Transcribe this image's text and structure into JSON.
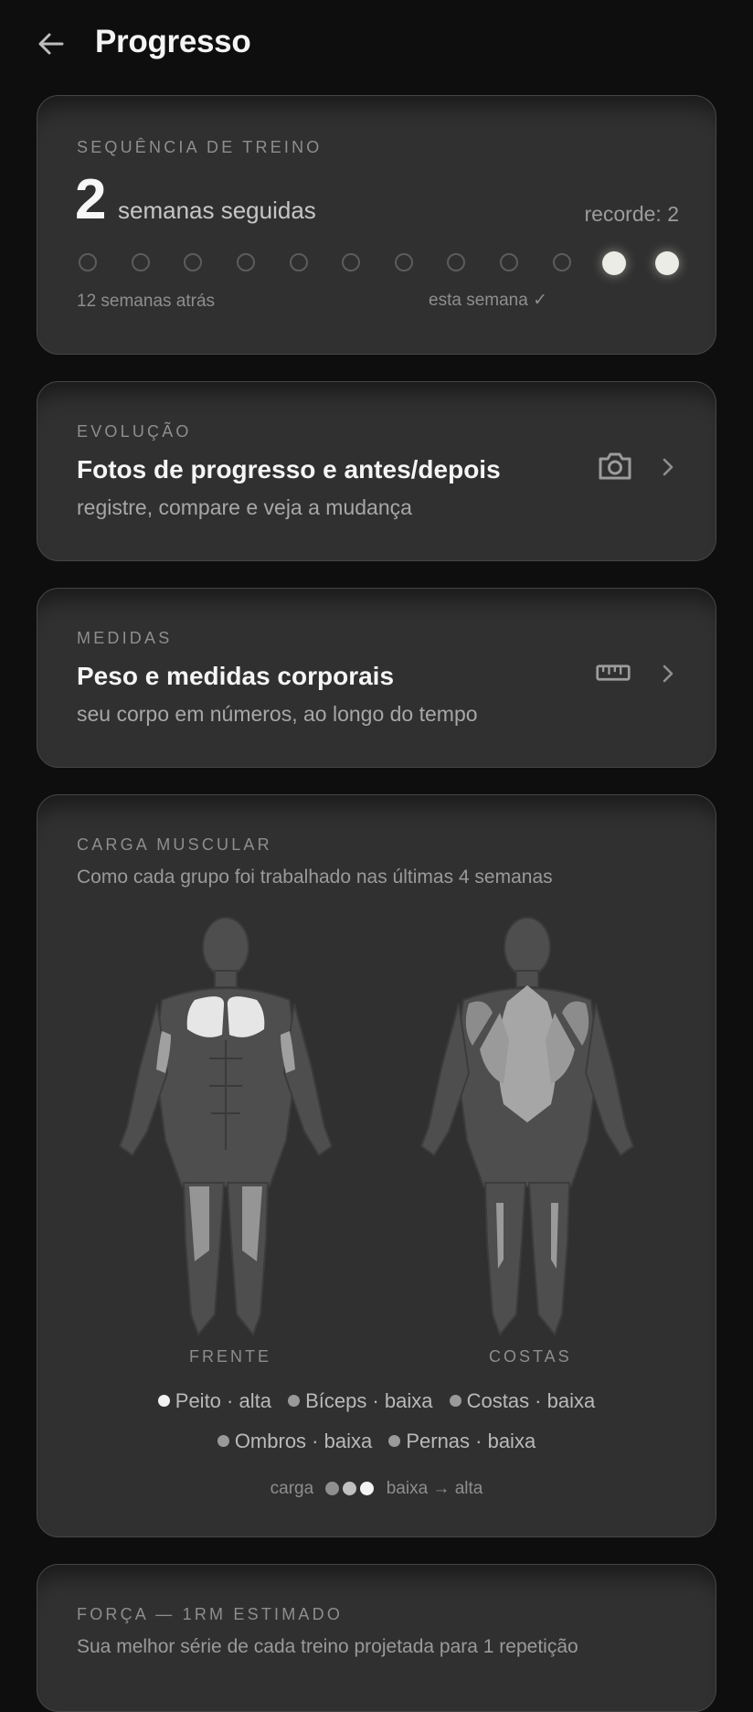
{
  "header": {
    "title": "Progresso"
  },
  "streak": {
    "overline": "SEQUÊNCIA DE TREINO",
    "count": "2",
    "count_label": "semanas seguidas",
    "record": "recorde: 2",
    "weeks_active": [
      false,
      false,
      false,
      false,
      false,
      false,
      false,
      false,
      false,
      false,
      true,
      true
    ],
    "start_label": "12 semanas atrás",
    "end_label": "esta semana ✓"
  },
  "evolution": {
    "overline": "EVOLUÇÃO",
    "title": "Fotos de progresso e antes/depois",
    "subtitle": "registre, compare e veja a mudança",
    "icon": "camera-icon"
  },
  "measures": {
    "overline": "MEDIDAS",
    "title": "Peso e medidas corporais",
    "subtitle": "seu corpo em números, ao longo do tempo",
    "icon": "ruler-icon"
  },
  "muscle_load": {
    "overline": "CARGA MUSCULAR",
    "subtitle": "Como cada grupo foi trabalhado nas últimas 4 semanas",
    "front_label": "FRENTE",
    "back_label": "COSTAS",
    "legend": [
      {
        "label": "Peito · alta",
        "level": "alta"
      },
      {
        "label": "Bíceps · baixa",
        "level": "baixa"
      },
      {
        "label": "Costas · baixa",
        "level": "baixa"
      },
      {
        "label": "Ombros · baixa",
        "level": "baixa"
      },
      {
        "label": "Pernas · baixa",
        "level": "baixa"
      }
    ],
    "scale_prefix": "carga",
    "scale_suffix": "baixa → alta"
  },
  "strength": {
    "overline": "FORÇA — 1RM ESTIMADO",
    "subtitle": "Sua melhor série de cada treino projetada para 1 repetição"
  },
  "colors": {
    "background": "#0e0e0e",
    "card": "#303030",
    "high": "#f2f2f2",
    "low": "#9a9a9a"
  }
}
